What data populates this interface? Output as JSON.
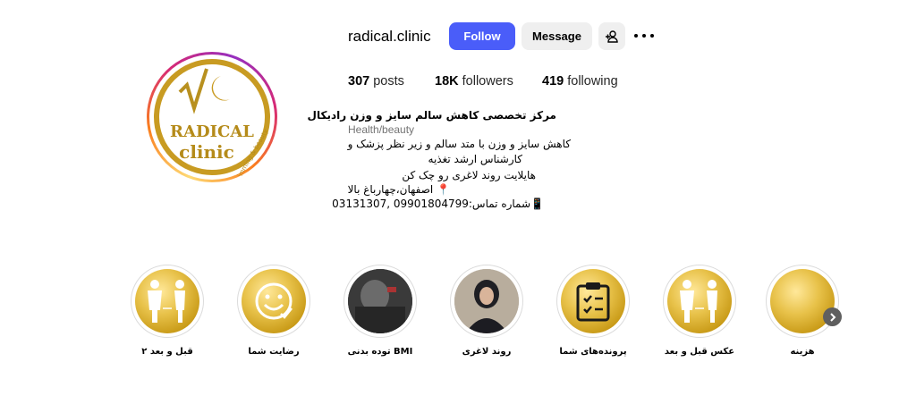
{
  "profile": {
    "username": "radical.clinic",
    "follow_label": "Follow",
    "message_label": "Message",
    "avatar_logo_line1": "RADICAL",
    "avatar_logo_line2": "clinic",
    "avatar_logo_arc": "slimming & beauty"
  },
  "stats": {
    "posts_count": "307",
    "posts_label": "posts",
    "followers_count": "18K",
    "followers_label": "followers",
    "following_count": "419",
    "following_label": "following"
  },
  "bio": {
    "name": "مرکز تخصصی کاهش سالم سایز و وزن رادیکال",
    "category": "Health/beauty",
    "line1": "کاهش سایز و وزن با متد سالم و زیر نظر پزشک و",
    "line2": "کارشناس ارشد تغذیه",
    "line3": "هایلایت روند لاغری رو چک کن",
    "line4": "📍 اصفهان،چهارباغ بالا",
    "line5": "📱شماره تماس:09901804799 ,03131307"
  },
  "highlights": [
    {
      "label": "قبل و بعد ۲",
      "icon": "before-after-figures-icon"
    },
    {
      "label": "رضایت شما",
      "icon": "smile-face-icon"
    },
    {
      "label": "توده بدنی BMI",
      "icon": "photo-thumbnail"
    },
    {
      "label": "روند لاغری",
      "icon": "portrait-thumbnail"
    },
    {
      "label": "پرونده‌های شما",
      "icon": "clipboard-check-icon"
    },
    {
      "label": "عکس قبل و بعد",
      "icon": "before-after-figures-icon"
    },
    {
      "label": "هزینه",
      "icon": "gold-circle"
    }
  ],
  "colors": {
    "follow_button": "#4a5df9",
    "secondary_button": "#efefef",
    "gold": "#d4a82a"
  }
}
